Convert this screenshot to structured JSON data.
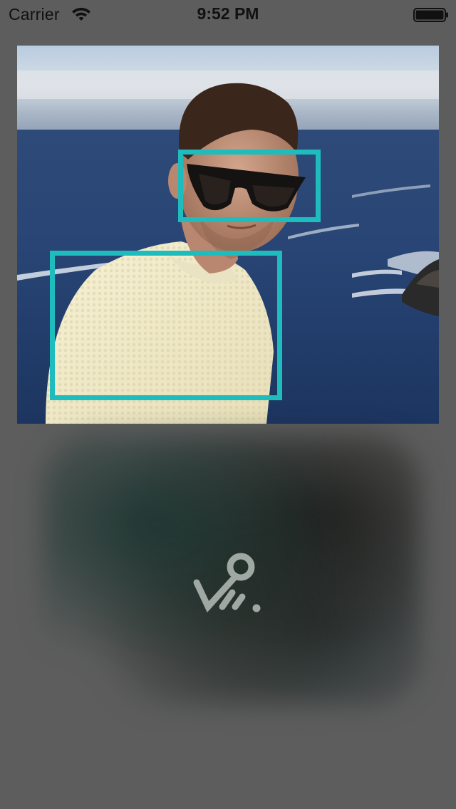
{
  "status_bar": {
    "carrier": "Carrier",
    "time": "9:52 PM",
    "wifi_icon": "wifi-icon",
    "battery_icon": "battery-full-icon"
  },
  "photo": {
    "subject": "man-with-sunglasses-ocean",
    "detections": [
      {
        "label": "sunglasses"
      },
      {
        "label": "sweater"
      }
    ],
    "box_color": "#1fbcbd"
  },
  "preview": {
    "icon": "app-logo-icon",
    "logo_color": "#9fa8a3"
  },
  "colors": {
    "background": "#5d5d5d"
  }
}
